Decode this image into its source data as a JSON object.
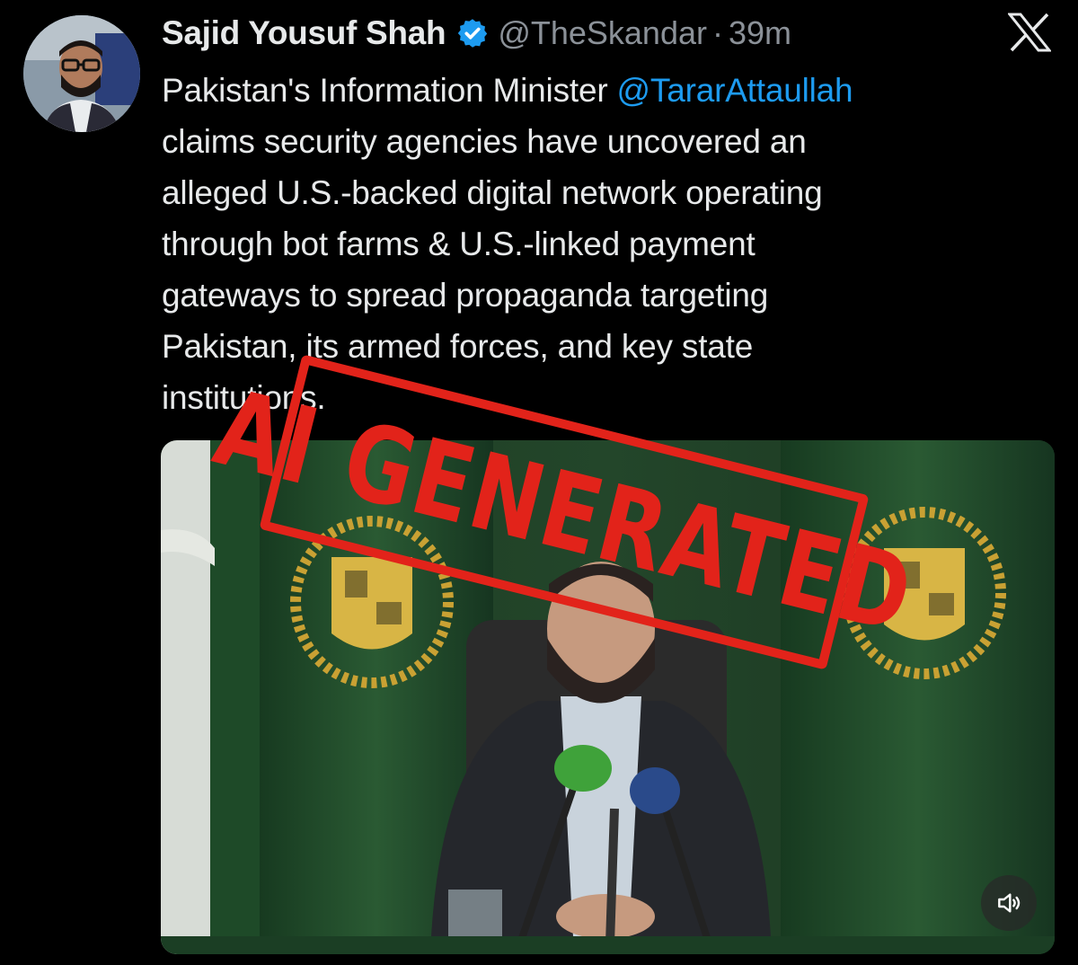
{
  "author": {
    "name": "Sajid Yousuf Shah",
    "handle": "@TheSkandar",
    "separator": "·",
    "time": "39m",
    "verified_icon": "verified-badge-icon",
    "avatar_icon": "profile-photo"
  },
  "platform": {
    "logo": "x-logo-icon"
  },
  "tweet": {
    "lines": [
      {
        "before": "Pakistan's Information Minister ",
        "mention": "@TararAttaullah"
      },
      "claims security agencies have uncovered an",
      "alleged U.S.-backed digital network operating",
      "through bot farms & U.S.-linked payment",
      "gateways to spread propaganda targeting",
      "Pakistan, its armed forces, and key state",
      "institutions."
    ]
  },
  "media": {
    "stamp_text": "AI GENERATED",
    "sound_icon": "speaker-icon"
  },
  "colors": {
    "background": "#000000",
    "text": "#e7e9ea",
    "secondary": "#8b9198",
    "link": "#1d9bf0",
    "verified": "#1d9bf0",
    "stamp": "#e2231a",
    "flag_green": "#1f4d2a"
  }
}
